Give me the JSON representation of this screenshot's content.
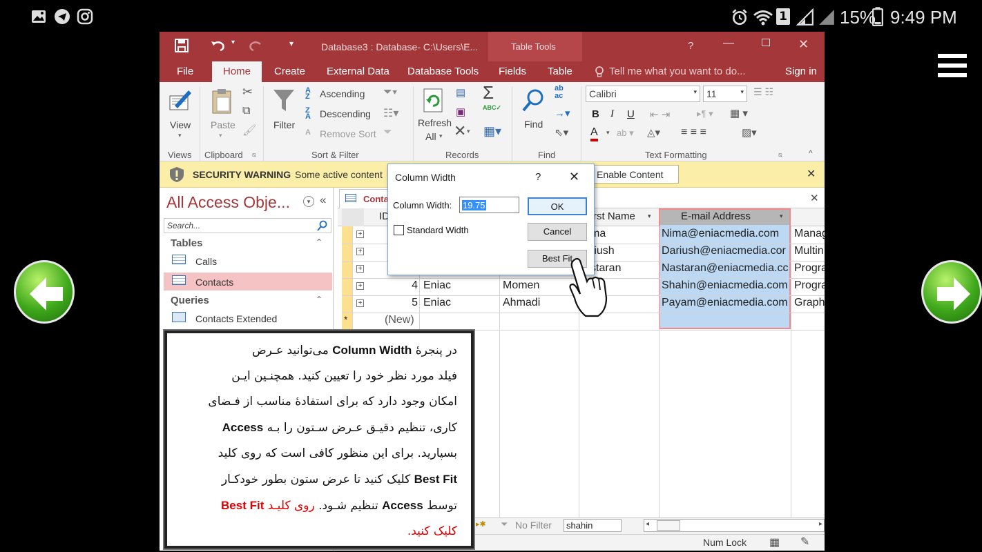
{
  "status_bar": {
    "battery_percent": "15%",
    "time": "9:49 PM",
    "sim_badge": "1",
    "icons": [
      "gallery-icon",
      "telegram-icon",
      "instagram-icon",
      "alarm-icon",
      "wifi-icon",
      "signal-icon",
      "battery-icon"
    ]
  },
  "window": {
    "title": "Database3 : Database- C:\\Users\\E...",
    "contextual_title": "Table Tools",
    "help": "?",
    "tabs": [
      "File",
      "Home",
      "Create",
      "External Data",
      "Database Tools",
      "Fields",
      "Table"
    ],
    "tell_me": "Tell me what you want to do...",
    "sign_in": "Sign in"
  },
  "ribbon": {
    "view": "View",
    "paste": "Paste",
    "filter": "Filter",
    "ascending": "Ascending",
    "descending": "Descending",
    "remove_sort": "Remove Sort",
    "refresh": "Refresh",
    "all": "All",
    "find": "Find",
    "font_name": "Calibri",
    "font_size": "11",
    "groups": {
      "views": "Views",
      "clipboard": "Clipboard",
      "sort_filter": "Sort & Filter",
      "records": "Records",
      "find": "Find",
      "text_formatting": "Text Formatting"
    }
  },
  "security": {
    "label": "SECURITY WARNING",
    "text": "Some active content",
    "button": "Enable Content"
  },
  "nav": {
    "title": "All Access Obje...",
    "search_placeholder": "Search...",
    "sections": [
      {
        "title": "Tables",
        "items": [
          "Calls",
          "Contacts"
        ]
      },
      {
        "title": "Queries",
        "items": [
          "Contacts Extended"
        ]
      }
    ]
  },
  "table": {
    "tab_label": "Conta",
    "col_id": "ID",
    "col_first": "rst Name",
    "col_email": "E-mail Address",
    "rows": [
      {
        "id": "",
        "company": "",
        "first": "ma",
        "email": "Nima@eniacmedia.com",
        "job": "Manag"
      },
      {
        "id": "",
        "company": "",
        "first": "riush",
        "email": "Dariush@eniacmedia.cor",
        "job": "Multin"
      },
      {
        "id": "",
        "company": "",
        "first": "staran",
        "email": "Nastaran@eniacmedia.cc",
        "job": "Progra"
      },
      {
        "id": "4",
        "company": "Eniac",
        "first": "Momen",
        "email": "Shahin@eniacmedia.com",
        "job": "Progra",
        "last_partial": "in"
      },
      {
        "id": "5",
        "company": "Eniac",
        "first": "Ahmadi",
        "email": "Payam@eniacmedia.com",
        "job": "Graph"
      }
    ],
    "new_row": "(New)",
    "new_marker": "*"
  },
  "record_nav": {
    "no_filter": "No Filter",
    "search_value": "shahin"
  },
  "status": {
    "num_lock": "Num Lock"
  },
  "dialog": {
    "title": "Column Width",
    "help": "?",
    "label": "Column Width:",
    "value": "19.75",
    "checkbox": "Standard Width",
    "ok": "OK",
    "cancel": "Cancel",
    "best_fit": "Best Fit"
  },
  "note": {
    "l1a": "در پنجرهٔ",
    "l1b": "Column Width",
    "l1c": "می‌توانید عـرض",
    "l2": "فیلد مورد نظر خود را تعیین کنید. همچنـین ایـن",
    "l3": "امکان وجود دارد که برای استفادهٔ مناسب از فـضای",
    "l4a": "کاری، تنظیم دقیـق عـرض سـتون را بـه",
    "l4b": "Access",
    "l5": "بسپارید. برای این منظور کافی است که روی کلید",
    "l6a": "Best Fit",
    "l6b": "کلیک کنید تا عرض ستون بطور خودکـار",
    "l7a": "توسط",
    "l7b": "Access",
    "l7c": "تنظیم شـود.",
    "l7d": "روی کلیـد",
    "l7e": "Best Fit",
    "l8": "کلیک کنید."
  },
  "colors": {
    "access_red": "#a4373a",
    "warning_yellow": "#fbeea8",
    "selected_column": "#bcd8f2",
    "nav_selected": "#f5c3c4",
    "highlight_text": "#e00000"
  }
}
